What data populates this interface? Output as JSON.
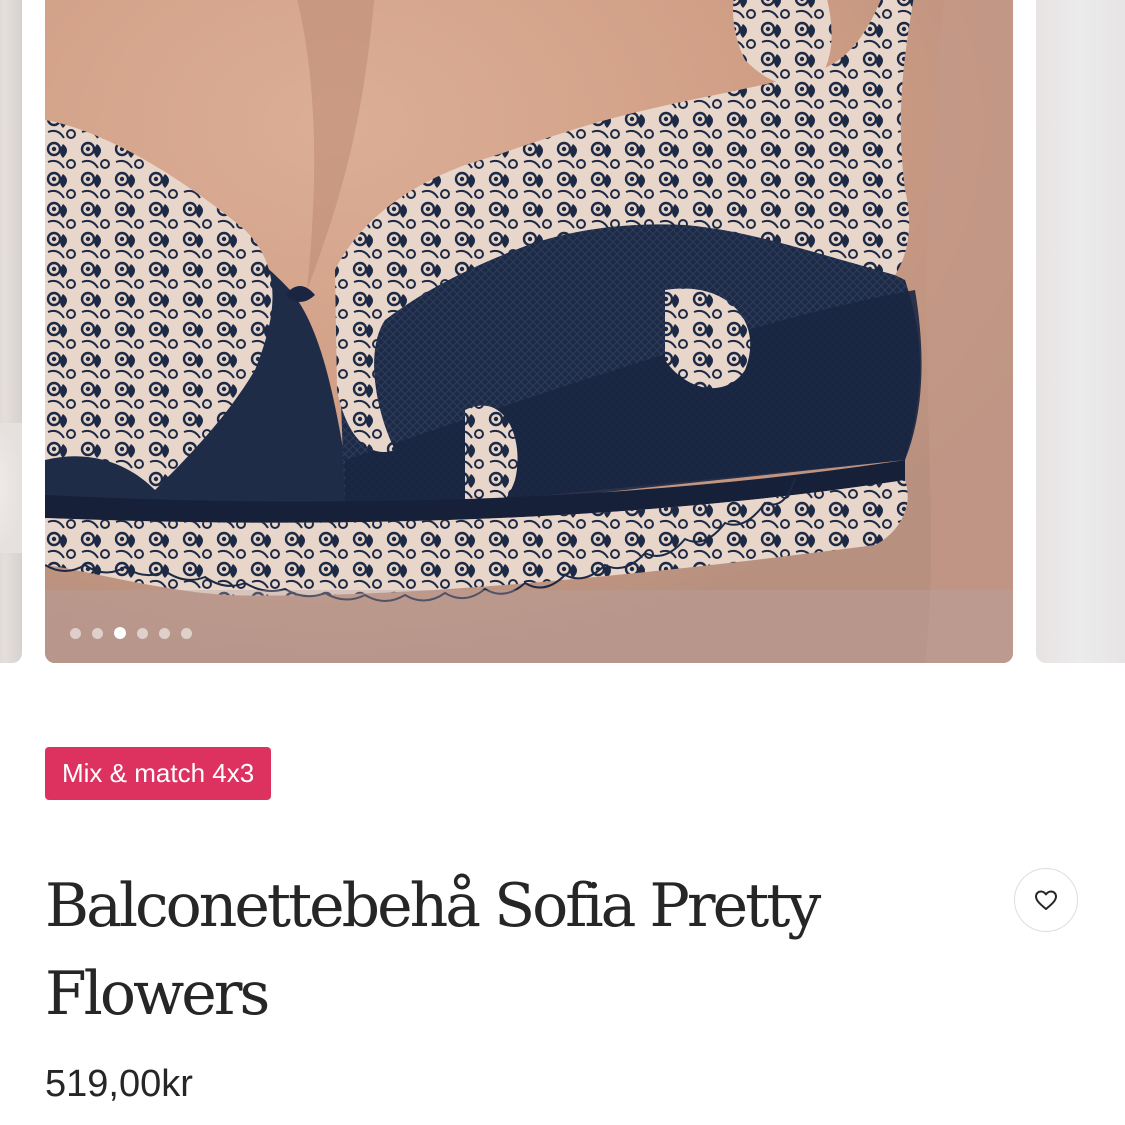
{
  "carousel": {
    "slide_count": 6,
    "active_index": 2,
    "image": "navy-lace-balconette-bra-photo"
  },
  "product": {
    "promo_badge": "Mix & match 4x3",
    "title": "Balconettebehå Sofia Pretty Flowers",
    "price": "519,00kr"
  },
  "icons": {
    "favorite": "heart-outline-icon"
  },
  "colors": {
    "badge_background": "#dd3160",
    "badge_text": "#ffffff",
    "text_primary": "#262626",
    "fav_border": "#dedede"
  }
}
